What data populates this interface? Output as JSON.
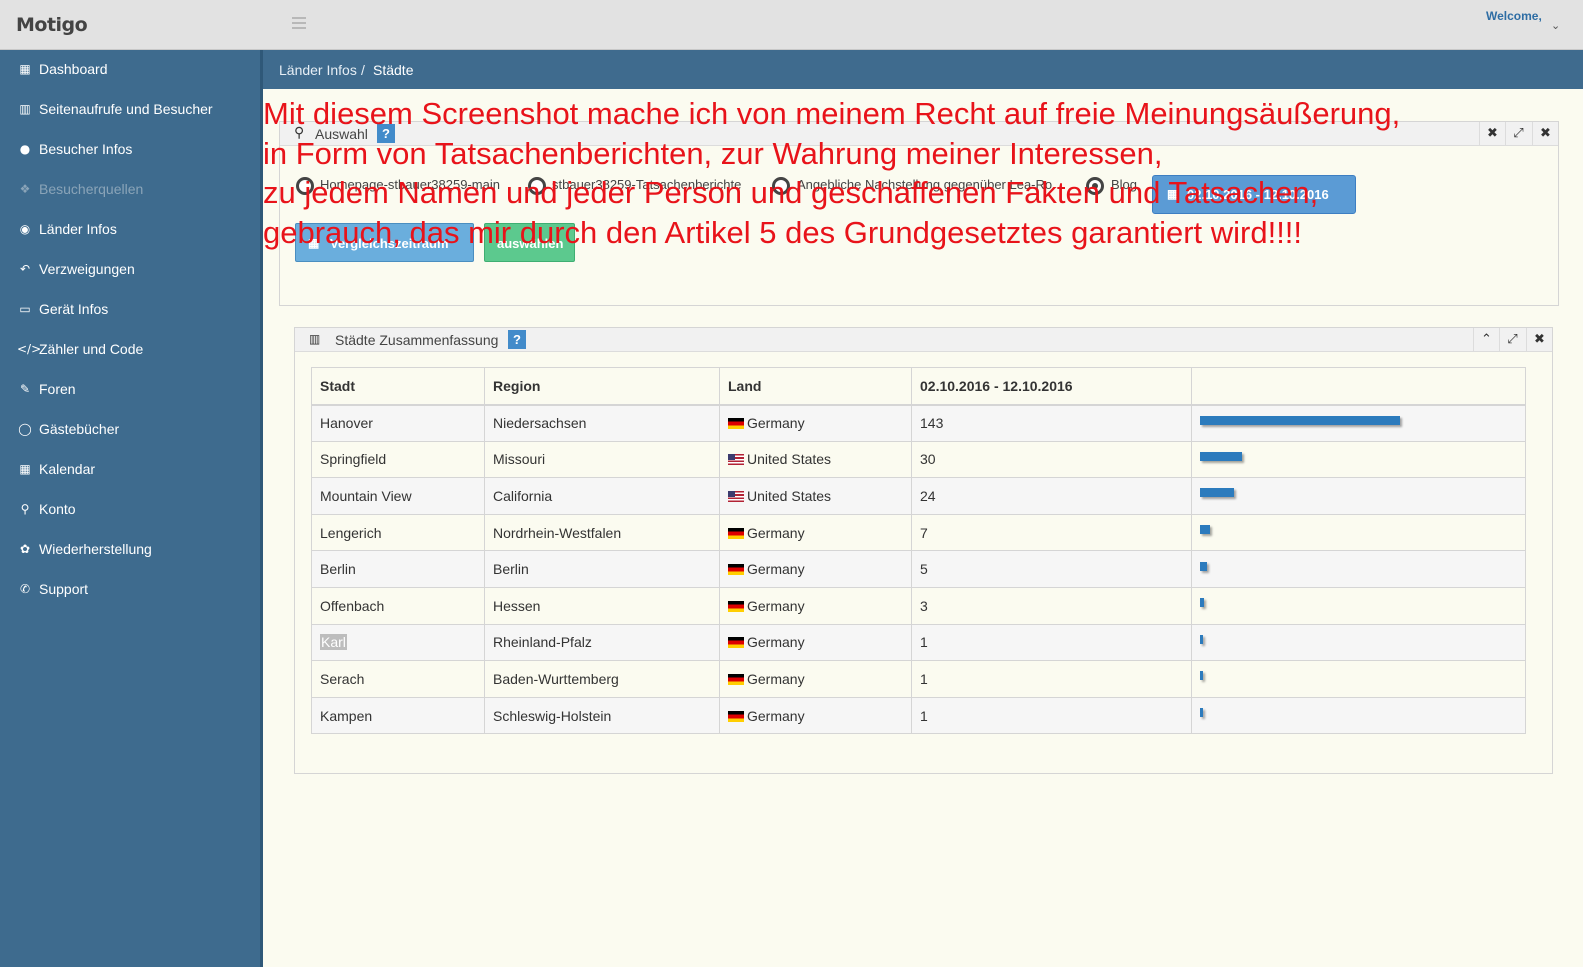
{
  "app": {
    "logo": "Motigo",
    "welcome": "Welcome,"
  },
  "sidebar": {
    "items": [
      {
        "label": "Dashboard",
        "icon": "table-icon"
      },
      {
        "label": "Seitenaufrufe und Besucher",
        "icon": "bar-chart-icon"
      },
      {
        "label": "Besucher Infos",
        "icon": "user-icon"
      },
      {
        "label": "Besucherquellen",
        "icon": "puzzle-icon",
        "disabled": true
      },
      {
        "label": "Länder Infos",
        "icon": "globe-icon"
      },
      {
        "label": "Verzweigungen",
        "icon": "reply-icon"
      },
      {
        "label": "Gerät Infos",
        "icon": "monitor-icon"
      },
      {
        "label": "Zähler und Code",
        "icon": "code-icon"
      },
      {
        "label": "Foren",
        "icon": "edit-icon"
      },
      {
        "label": "Gästebücher",
        "icon": "comment-icon"
      },
      {
        "label": "Kalendar",
        "icon": "calendar-icon"
      },
      {
        "label": "Konto",
        "icon": "key-icon"
      },
      {
        "label": "Wiederherstellung",
        "icon": "wrench-icon"
      },
      {
        "label": "Support",
        "icon": "phone-icon"
      }
    ]
  },
  "breadcrumb": {
    "parent": "Länder Infos",
    "separator": "/",
    "current": "Städte"
  },
  "selection": {
    "title": "Auswahl",
    "help": "?",
    "radios": [
      {
        "label": "Homepage-stbauer38259-main"
      },
      {
        "label": "stbauer38259-Tatsachenberichte"
      },
      {
        "label": "Angebliche Nachstellung gegenüber Lea-Ro"
      },
      {
        "label": "Blog"
      }
    ],
    "date_button": "02.10.2016 - 12.10.2016",
    "compare_button": "Vergleichszeitraum",
    "select_button": "auswählen"
  },
  "summary": {
    "title": "Städte Zusammenfassung",
    "help": "?",
    "columns": [
      "Stadt",
      "Region",
      "Land",
      "02.10.2016 - 12.10.2016",
      ""
    ],
    "rows": [
      {
        "city": "Hanover",
        "region": "Niedersachsen",
        "country": "Germany",
        "flag": "de",
        "count": "143",
        "share": 1.0
      },
      {
        "city": "Springfield",
        "region": "Missouri",
        "country": "United States",
        "flag": "us",
        "count": "30",
        "share": 0.21
      },
      {
        "city": "Mountain View",
        "region": "California",
        "country": "United States",
        "flag": "us",
        "count": "24",
        "share": 0.17
      },
      {
        "city": "Lengerich",
        "region": "Nordrhein-Westfalen",
        "country": "Germany",
        "flag": "de",
        "count": "7",
        "share": 0.05
      },
      {
        "city": "Berlin",
        "region": "Berlin",
        "country": "Germany",
        "flag": "de",
        "count": "5",
        "share": 0.035
      },
      {
        "city": "Offenbach",
        "region": "Hessen",
        "country": "Germany",
        "flag": "de",
        "count": "3",
        "share": 0.021
      },
      {
        "city": "Karl",
        "region": "Rheinland-Pfalz",
        "country": "Germany",
        "flag": "de",
        "count": "1",
        "share": 0.007,
        "highlight": true
      },
      {
        "city": "Serach",
        "region": "Baden-Wurttemberg",
        "country": "Germany",
        "flag": "de",
        "count": "1",
        "share": 0.007
      },
      {
        "city": "Kampen",
        "region": "Schleswig-Holstein",
        "country": "Germany",
        "flag": "de",
        "count": "1",
        "share": 0.007
      }
    ]
  },
  "overlay": {
    "lines": [
      "Mit diesem Screenshot mache ich von meinem Recht auf freie Meinungsäußerung,",
      "in Form von Tatsachenberichten, zur Wahrung meiner Interessen,",
      "zu jedem Namen und jeder Person und geschaffenen Fakten und Tatsachen,",
      "gebrauch, das mir durch den Artikel 5 des Grundgesetztes garantiert wird!!!!"
    ]
  },
  "colors": {
    "sidebar": "#3e6b8e",
    "accent": "#2c7bbd",
    "overlay_text": "#e8131a",
    "select_button": "#5cc98e"
  }
}
